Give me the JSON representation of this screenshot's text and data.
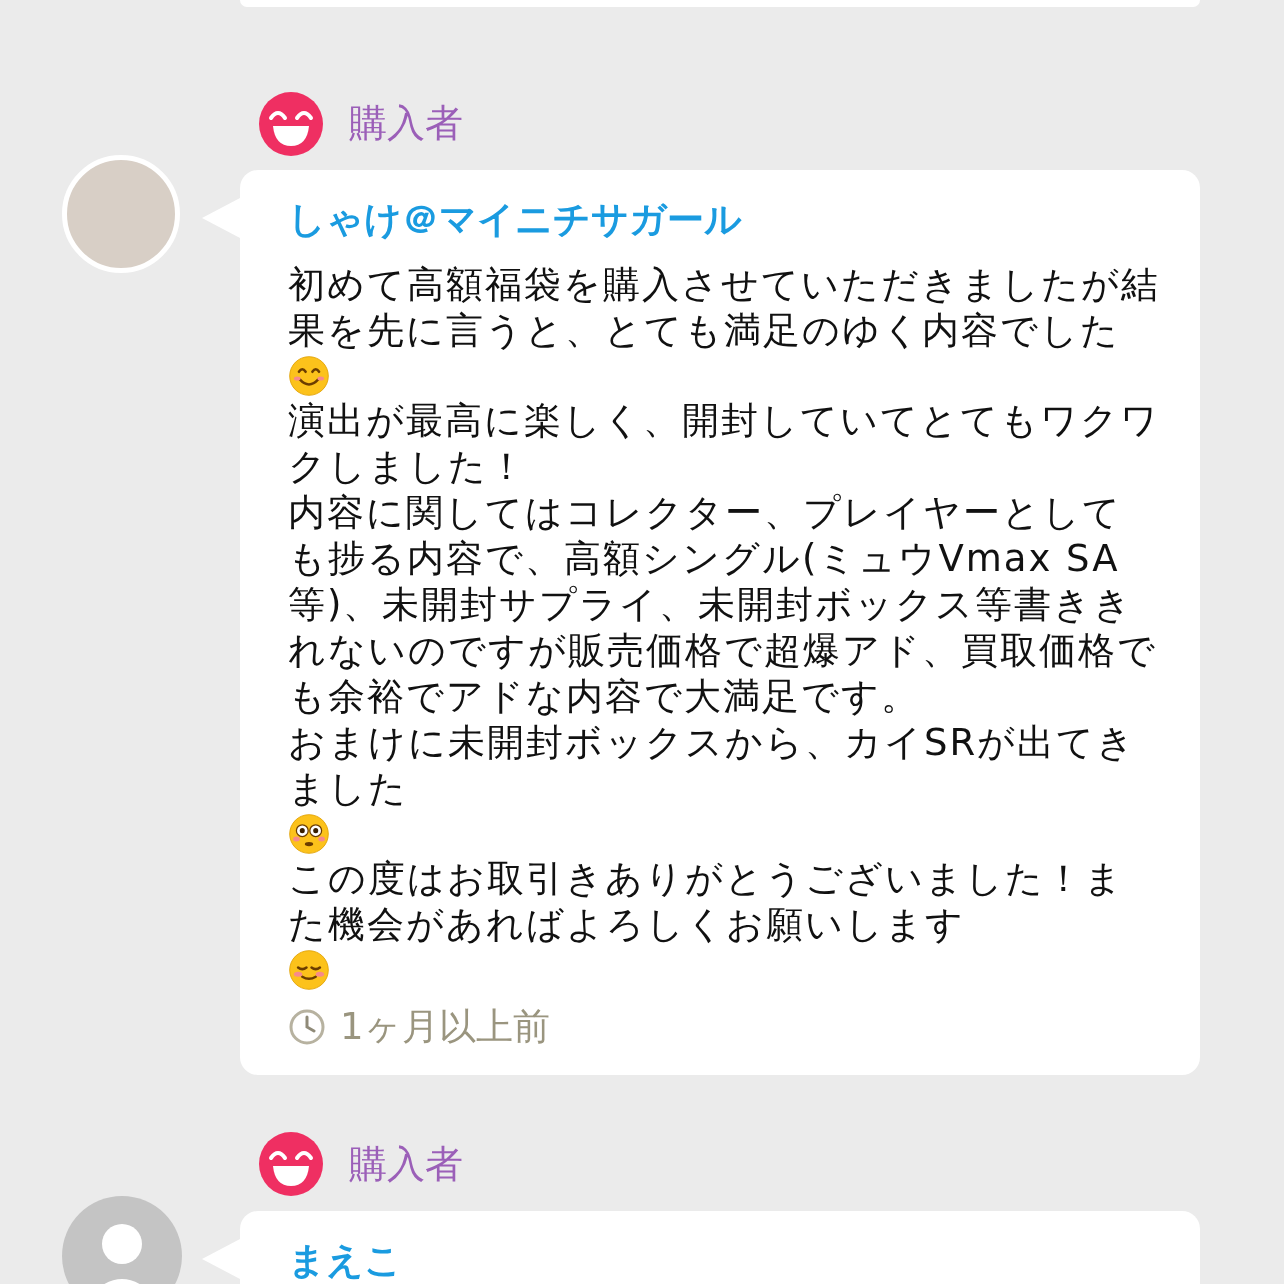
{
  "reviews": [
    {
      "kind": "illustrated-avatar",
      "role": "購入者",
      "name": "しゃけ＠マイニチサガール",
      "paragraphs": [
        {
          "text": "初めて高額福袋を購入させていただきましたが結果を先に言うと、とても満足のゆく内容でした",
          "kind": "smile"
        },
        {
          "text": "演出が最高に楽しく、開封していてとてもワクワクしました！",
          "kind": "plain"
        },
        {
          "text": "内容に関してはコレクター、プレイヤーとしても捗る内容で、高額シングル(ミュウVmax SA等)、未開封サプライ、未開封ボックス等書ききれないのですが販売価格で超爆アド、買取価格でも余裕でアドな内容で大満足です。",
          "kind": "plain"
        },
        {
          "text": "おまけに未開封ボックスから、カイSRが出てきました",
          "kind": "flushed"
        },
        {
          "text": "この度はお取引きありがとうございました！また機会があればよろしくお願いします",
          "kind": "blush"
        }
      ],
      "time": "1ヶ月以上前"
    },
    {
      "kind": "default-avatar",
      "role": "購入者",
      "name": "まえこ"
    }
  ]
}
